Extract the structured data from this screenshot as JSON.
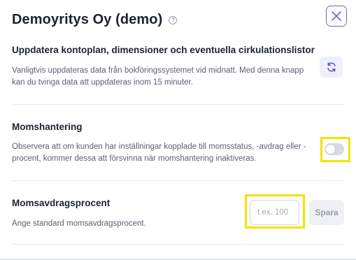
{
  "header": {
    "title": "Demoyritys Oy (demo)",
    "help_icon": "question-circle-icon",
    "close_icon": "close-x-icon"
  },
  "sections": {
    "update": {
      "title": "Uppdatera kontoplan, dimensioner och eventuella cirkulationslistor",
      "description": "Vanligtvis uppdateras data från bokföringssystemet vid midnatt. Med denna knapp kan du tvinga data att uppdateras inom 15 minuter.",
      "button_icon": "refresh-icon"
    },
    "vat_handling": {
      "title": "Momshantering",
      "description": "Observera att om kunden har inställningar kopplade till momsstatus, -avdrag eller -procent, kommer dessa att försvinna när momshantering inaktiveras.",
      "toggle_on": false
    },
    "vat_deduction": {
      "title": "Momsavdragsprocent",
      "description": "Ange standard momsavdragsprocent.",
      "input_value": "",
      "input_placeholder": "t.ex. 100",
      "save_label": "Spara"
    }
  },
  "colors": {
    "accent": "#6f5fd8",
    "highlight": "#f5e100",
    "toggle_off": "#d6d9df"
  }
}
